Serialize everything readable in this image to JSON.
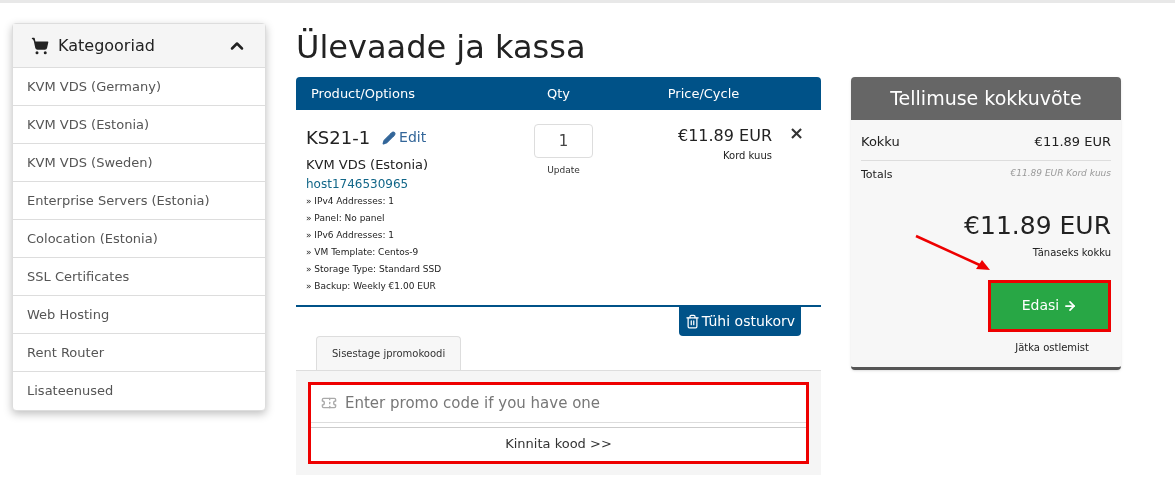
{
  "sidebar": {
    "title": "Kategooriad",
    "expanded": true,
    "items": [
      {
        "label": "KVM VDS (Germany)"
      },
      {
        "label": "KVM VDS (Estonia)"
      },
      {
        "label": "KVM VDS (Sweden)"
      },
      {
        "label": "Enterprise Servers (Estonia)"
      },
      {
        "label": "Colocation (Estonia)"
      },
      {
        "label": "SSL Certificates"
      },
      {
        "label": "Web Hosting"
      },
      {
        "label": "Rent Router"
      },
      {
        "label": "Lisateenused"
      }
    ]
  },
  "page_title": "Ülevaade ja kassa",
  "cart": {
    "columns": [
      "Product/Options",
      "Qty",
      "Price/Cycle"
    ],
    "item": {
      "name": "KS21-1",
      "edit": "Edit",
      "group": "KVM VDS (Estonia)",
      "hostname": "host1746530965",
      "options": [
        "» IPv4 Addresses: 1",
        "» Panel: No panel",
        "» IPv6 Addresses: 1",
        "» VM Template: Centos-9",
        "» Storage Type: Standard SSD",
        "» Backup: Weekly €1.00 EUR"
      ],
      "qty": "1",
      "update": "Update",
      "price": "€11.89 EUR",
      "cycle": "Kord kuus",
      "remove": "×"
    },
    "empty_button": "Tühi ostukorv"
  },
  "promo": {
    "tab": "Sisestage jpromokoodi",
    "placeholder": "Enter promo code if you have one",
    "apply": "Kinnita kood >>",
    "highlighted": true
  },
  "summary": {
    "title": "Tellimuse kokkuvõte",
    "rows": [
      {
        "label": "Kokku",
        "value": "€11.89 EUR"
      },
      {
        "label": "Totals",
        "value": "€11.89 EUR Kord kuus"
      }
    ],
    "total": "€11.89 EUR",
    "total_label": "Tänaseks kokku",
    "checkout": "Edasi",
    "checkout_highlighted": true,
    "continue": "Jätka ostlemist"
  }
}
